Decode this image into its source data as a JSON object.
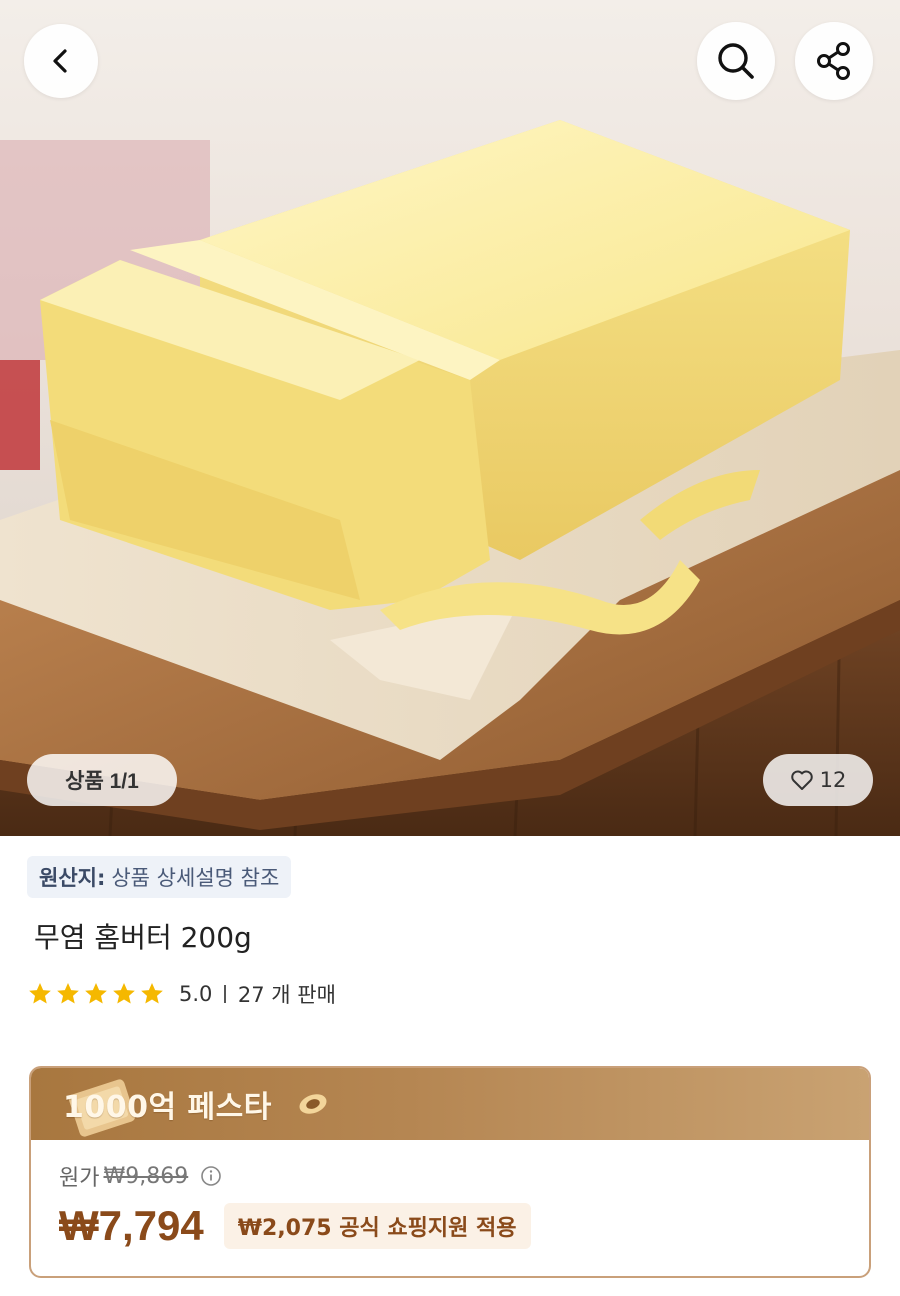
{
  "nav": {
    "back_icon": "chevron-left-icon",
    "search_icon": "search-icon",
    "share_icon": "share-icon"
  },
  "gallery": {
    "image_subject": "butter block on cutting board",
    "page_indicator": "상품 1/1",
    "like_count": "12"
  },
  "product": {
    "origin_label": "원산지:",
    "origin_value": "상품 상세설명 참조",
    "title": "무염 홈버터 200g",
    "rating_stars": 5,
    "rating": "5.0",
    "sold": "27 개 판매"
  },
  "deal": {
    "banner_title": "1000억 페스타",
    "original_label": "원가",
    "original_price": "₩9,869",
    "final_price": "₩7,794",
    "support_text": "₩2,075 공식 쇼핑지원 적용"
  },
  "colors": {
    "star": "#f5b800",
    "accent_brown": "#8a4a1a",
    "banner_gold": "#b58652"
  }
}
